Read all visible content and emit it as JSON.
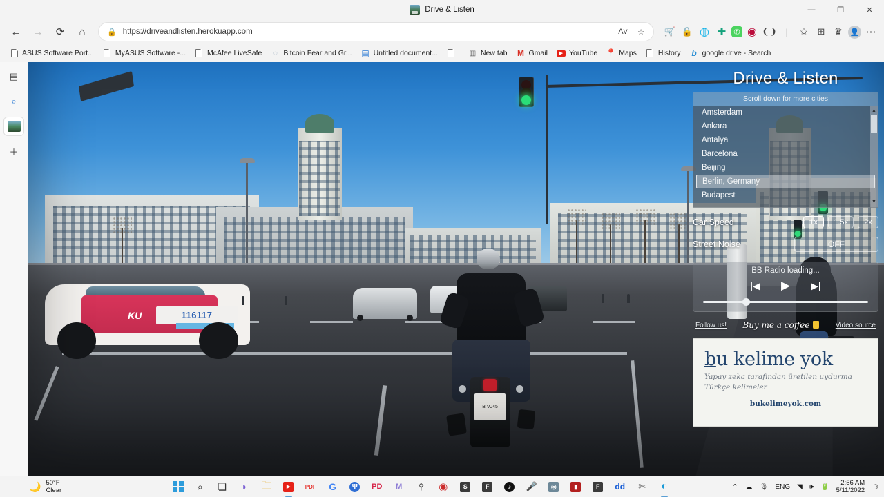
{
  "window": {
    "tab_title": "Drive & Listen",
    "minimize": "—",
    "maximize": "❐",
    "close": "✕"
  },
  "toolbar": {
    "back": "←",
    "forward": "→",
    "refresh": "⟳",
    "home": "⌂",
    "url": "https://driveandlisten.herokuapp.com",
    "lock_icon": "lock-icon",
    "read_aloud": "A",
    "favorite": "☆",
    "extensions": [
      {
        "name": "shopping-cart-icon",
        "glyph": "🛒",
        "color": "#c23b67"
      },
      {
        "name": "lastpass-icon",
        "glyph": "🔒",
        "color": "#c0392b"
      },
      {
        "name": "circle-blue-icon",
        "glyph": "◍",
        "color": "#15b3e8"
      },
      {
        "name": "plus-icon",
        "glyph": "✚",
        "color": "#12a17b"
      },
      {
        "name": "whatsapp-icon",
        "glyph": "✆",
        "color": "#4bd35f"
      },
      {
        "name": "opera-icon",
        "glyph": "◉",
        "color": "#bb0b3a"
      },
      {
        "name": "split-screen-icon",
        "glyph": "❨❩",
        "color": "#444"
      },
      {
        "name": "collections-icon",
        "glyph": "✎",
        "color": "#444"
      },
      {
        "name": "browser-essentials-icon",
        "glyph": "⊞",
        "color": "#444"
      },
      {
        "name": "rewards-icon",
        "glyph": "♛",
        "color": "#444"
      },
      {
        "name": "profile-avatar",
        "glyph": "●",
        "color": "#9aa0a6"
      },
      {
        "name": "settings-more-icon",
        "glyph": "⋯",
        "color": "#444"
      }
    ]
  },
  "bookmarks": [
    {
      "label": "ASUS Software Port...",
      "icon": "page-icon"
    },
    {
      "label": "MyASUS Software -...",
      "icon": "page-icon"
    },
    {
      "label": "McAfee LiveSafe",
      "icon": "page-icon"
    },
    {
      "label": "Bitcoin Fear and Gr...",
      "icon": "drop-icon"
    },
    {
      "label": "Untitled document...",
      "icon": "docs-icon"
    },
    {
      "label": "",
      "icon": "page-icon"
    },
    {
      "label": "New tab",
      "icon": "newtab-icon"
    },
    {
      "label": "Gmail",
      "icon": "gmail-icon"
    },
    {
      "label": "YouTube",
      "icon": "youtube-icon"
    },
    {
      "label": "Maps",
      "icon": "maps-pin-icon"
    },
    {
      "label": "History",
      "icon": "page-icon"
    },
    {
      "label": "google drive - Search",
      "icon": "bing-icon"
    }
  ],
  "edge_sidebar": [
    {
      "name": "copilot-tab-icon",
      "glyph": "▤"
    },
    {
      "name": "search-icon",
      "glyph": "⌕"
    },
    {
      "name": "site-thumbnail-icon",
      "glyph": ""
    },
    {
      "name": "add-site-icon",
      "glyph": "＋"
    }
  ],
  "app": {
    "title": "Drive & Listen",
    "scroll_hint": "Scroll down for more cities",
    "cities": [
      "Amsterdam",
      "Ankara",
      "Antalya",
      "Barcelona",
      "Beijing",
      "Berlin, Germany",
      "Budapest"
    ],
    "selected_city": "Berlin, Germany",
    "car_speed": {
      "label": "Car Speed",
      "options": [
        "1x",
        "1.5x",
        "2x"
      ],
      "selected": "1x"
    },
    "street_noise": {
      "label": "Street Noise",
      "value": "OFF"
    },
    "radio": {
      "status": "BB Radio loading...",
      "prev_icon": "previous-track-icon",
      "play_icon": "play-icon",
      "next_icon": "next-track-icon",
      "prev_glyph": "|◀",
      "play_glyph": "▶",
      "next_glyph": "▶|",
      "volume_percent": 24
    },
    "links": {
      "follow": "Follow us!",
      "coffee": "Buy me a coffee",
      "video_source": "Video source"
    },
    "ad": {
      "title_first_letter": "b",
      "title": "bu kelime yok",
      "subtitle": "Yapay zeka tarafından üretilen uydurma Türkçe kelimeler",
      "url": "bukelimeyok.com"
    },
    "scene": {
      "taxi_number": "116117",
      "taxi_brand": "KU",
      "moto_plate": "B VJ45",
      "traffic_light": "green"
    }
  },
  "taskbar": {
    "weather_temp": "50°F",
    "weather_cond": "Clear",
    "weather_icon": "moon-icon",
    "apps": [
      {
        "name": "start-button",
        "glyph": "⊞",
        "color": "#2d9cdb"
      },
      {
        "name": "search-icon",
        "glyph": "⌕",
        "color": "#222"
      },
      {
        "name": "task-view-icon",
        "glyph": "❏",
        "color": "#333"
      },
      {
        "name": "chat-icon",
        "glyph": "💬",
        "color": "#7a5fd3"
      },
      {
        "name": "file-explorer-icon",
        "glyph": "🗀",
        "color": "#e8b339"
      },
      {
        "name": "youtube-icon",
        "glyph": "▶",
        "color": "#e62117"
      },
      {
        "name": "ilovepdf-icon",
        "glyph": "PDF",
        "color": "#e5322d"
      },
      {
        "name": "google-chrome-icon",
        "glyph": "G",
        "color": "#4285f4"
      },
      {
        "name": "wondershare-icon",
        "glyph": "Ψ",
        "color": "#2f6ed4"
      },
      {
        "name": "pdfelement-icon",
        "glyph": "PD",
        "color": "#d7264a"
      },
      {
        "name": "filmora-icon",
        "glyph": "M",
        "color": "#8f7fd6"
      },
      {
        "name": "paint-3d-icon",
        "glyph": "✠",
        "color": "#555"
      },
      {
        "name": "voice-recorder-icon",
        "glyph": "◉",
        "color": "#cc2b2b"
      },
      {
        "name": "slack-icon",
        "glyph": "S",
        "color": "#3b3b3b"
      },
      {
        "name": "figma-icon",
        "glyph": "F",
        "color": "#3b3b3b"
      },
      {
        "name": "tiktok-icon",
        "glyph": "♪",
        "color": "#111"
      },
      {
        "name": "microphone-icon",
        "glyph": "🎤",
        "color": "#4a9ede"
      },
      {
        "name": "gamepad-icon",
        "glyph": "◎",
        "color": "#6d8898"
      },
      {
        "name": "audacity-icon",
        "glyph": "▯",
        "color": "#b3201f"
      },
      {
        "name": "facebook-icon",
        "glyph": "F",
        "color": "#3b3b3b"
      },
      {
        "name": "dd-icon",
        "glyph": "dd",
        "color": "#1a5fd6"
      },
      {
        "name": "snipping-tool-icon",
        "glyph": "✂",
        "color": "#444"
      },
      {
        "name": "microsoft-edge-icon",
        "glyph": "e",
        "color": "#1a9ad7"
      }
    ],
    "tray": {
      "chevron": "⌃",
      "onedrive": "☁",
      "microphone": "🎤",
      "language": "ENG",
      "wifi": "▲",
      "volume": "◀))",
      "battery": "⊐",
      "time": "2:56 AM",
      "date": "5/11/2022",
      "notification": "🔔"
    }
  }
}
